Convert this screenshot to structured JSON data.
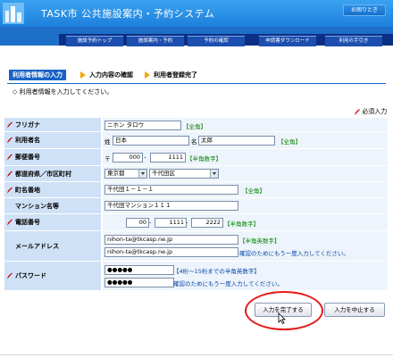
{
  "header": {
    "title": "TASK市  公共施設案内・予約システム",
    "help_label": "お困りとき"
  },
  "nav": {
    "tabs": [
      "施設予約トップ",
      "施設案内・予約",
      "予約の確認",
      "申請書ダウンロード",
      "利用の手引き"
    ]
  },
  "steps": {
    "step1": "利用者情報の入力",
    "step2": "入力内容の確認",
    "step3": "利用者登録完了"
  },
  "instruction": "◇ 利用者情報を入力してください。",
  "required_label": "必須入力",
  "form": {
    "furigana": {
      "label": "フリガナ",
      "value": "ニホン タロウ",
      "note": "【全角】"
    },
    "name": {
      "label": "利用者名",
      "sei_label": "姓",
      "sei": "日本",
      "mei_label": "名",
      "mei": "太郎",
      "note": "【全角】"
    },
    "postal": {
      "label": "郵便番号",
      "prefix": "〒",
      "part1": "000",
      "part2": "1111",
      "sep": "-",
      "note": "【半角数字】"
    },
    "pref": {
      "label": "都道府県／市区町村",
      "pref": "東京都",
      "city": "千代田区"
    },
    "street": {
      "label": "町名番地",
      "value": "千代田１－１－１",
      "note": "【全角】"
    },
    "building": {
      "label": "マンション名等",
      "value": "千代田マンション１１１"
    },
    "phone": {
      "label": "電話番号",
      "part1": "00",
      "part2": "1111",
      "part3": "2222",
      "sep": "-",
      "note": "【半角数字】"
    },
    "email": {
      "label": "メールアドレス",
      "value1": "nihon-ta@tkcasp.ne.jp",
      "value2": "nihon-ta@tkcasp.ne.jp",
      "note1": "【半角英数字】",
      "note2": "確認のためにもう一度入力してください。"
    },
    "password": {
      "label": "パスワード",
      "value1": "●●●●●",
      "value2": "●●●●●",
      "note1": "【4桁～15桁までの半角英数字】",
      "note2": "確認のためにもう一度入力してください。"
    }
  },
  "buttons": {
    "complete": "入力を完了する",
    "cancel": "入力を中止する"
  }
}
